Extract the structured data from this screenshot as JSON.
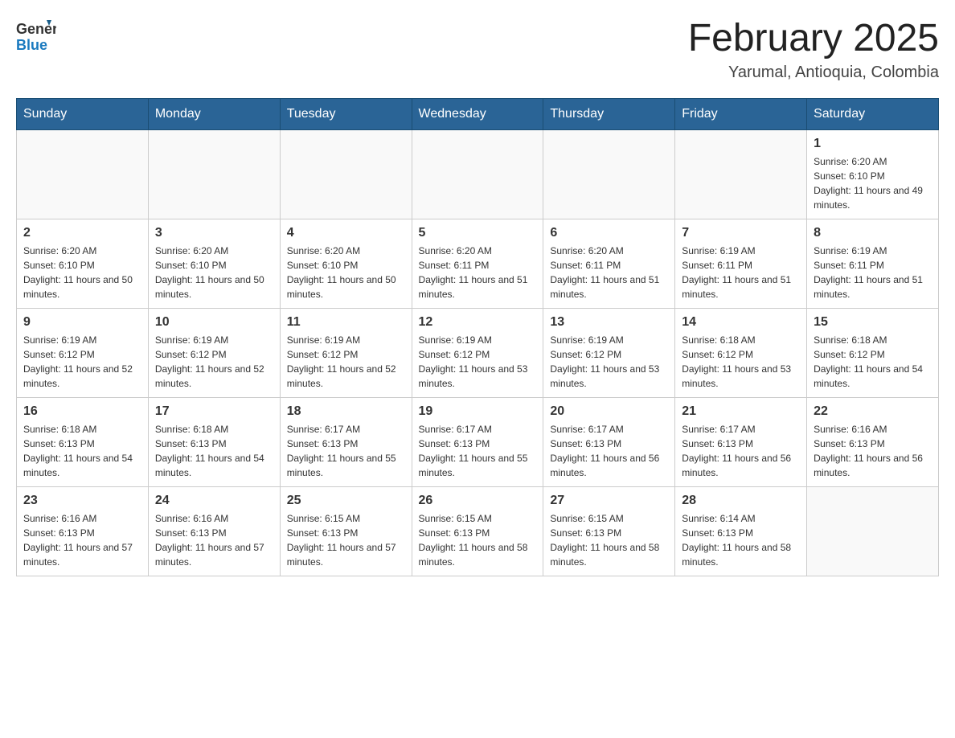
{
  "header": {
    "logo_general": "General",
    "logo_blue": "Blue",
    "month_title": "February 2025",
    "location": "Yarumal, Antioquia, Colombia"
  },
  "days_of_week": [
    "Sunday",
    "Monday",
    "Tuesday",
    "Wednesday",
    "Thursday",
    "Friday",
    "Saturday"
  ],
  "weeks": [
    [
      {
        "day": "",
        "sunrise": "",
        "sunset": "",
        "daylight": ""
      },
      {
        "day": "",
        "sunrise": "",
        "sunset": "",
        "daylight": ""
      },
      {
        "day": "",
        "sunrise": "",
        "sunset": "",
        "daylight": ""
      },
      {
        "day": "",
        "sunrise": "",
        "sunset": "",
        "daylight": ""
      },
      {
        "day": "",
        "sunrise": "",
        "sunset": "",
        "daylight": ""
      },
      {
        "day": "",
        "sunrise": "",
        "sunset": "",
        "daylight": ""
      },
      {
        "day": "1",
        "sunrise": "Sunrise: 6:20 AM",
        "sunset": "Sunset: 6:10 PM",
        "daylight": "Daylight: 11 hours and 49 minutes."
      }
    ],
    [
      {
        "day": "2",
        "sunrise": "Sunrise: 6:20 AM",
        "sunset": "Sunset: 6:10 PM",
        "daylight": "Daylight: 11 hours and 50 minutes."
      },
      {
        "day": "3",
        "sunrise": "Sunrise: 6:20 AM",
        "sunset": "Sunset: 6:10 PM",
        "daylight": "Daylight: 11 hours and 50 minutes."
      },
      {
        "day": "4",
        "sunrise": "Sunrise: 6:20 AM",
        "sunset": "Sunset: 6:10 PM",
        "daylight": "Daylight: 11 hours and 50 minutes."
      },
      {
        "day": "5",
        "sunrise": "Sunrise: 6:20 AM",
        "sunset": "Sunset: 6:11 PM",
        "daylight": "Daylight: 11 hours and 51 minutes."
      },
      {
        "day": "6",
        "sunrise": "Sunrise: 6:20 AM",
        "sunset": "Sunset: 6:11 PM",
        "daylight": "Daylight: 11 hours and 51 minutes."
      },
      {
        "day": "7",
        "sunrise": "Sunrise: 6:19 AM",
        "sunset": "Sunset: 6:11 PM",
        "daylight": "Daylight: 11 hours and 51 minutes."
      },
      {
        "day": "8",
        "sunrise": "Sunrise: 6:19 AM",
        "sunset": "Sunset: 6:11 PM",
        "daylight": "Daylight: 11 hours and 51 minutes."
      }
    ],
    [
      {
        "day": "9",
        "sunrise": "Sunrise: 6:19 AM",
        "sunset": "Sunset: 6:12 PM",
        "daylight": "Daylight: 11 hours and 52 minutes."
      },
      {
        "day": "10",
        "sunrise": "Sunrise: 6:19 AM",
        "sunset": "Sunset: 6:12 PM",
        "daylight": "Daylight: 11 hours and 52 minutes."
      },
      {
        "day": "11",
        "sunrise": "Sunrise: 6:19 AM",
        "sunset": "Sunset: 6:12 PM",
        "daylight": "Daylight: 11 hours and 52 minutes."
      },
      {
        "day": "12",
        "sunrise": "Sunrise: 6:19 AM",
        "sunset": "Sunset: 6:12 PM",
        "daylight": "Daylight: 11 hours and 53 minutes."
      },
      {
        "day": "13",
        "sunrise": "Sunrise: 6:19 AM",
        "sunset": "Sunset: 6:12 PM",
        "daylight": "Daylight: 11 hours and 53 minutes."
      },
      {
        "day": "14",
        "sunrise": "Sunrise: 6:18 AM",
        "sunset": "Sunset: 6:12 PM",
        "daylight": "Daylight: 11 hours and 53 minutes."
      },
      {
        "day": "15",
        "sunrise": "Sunrise: 6:18 AM",
        "sunset": "Sunset: 6:12 PM",
        "daylight": "Daylight: 11 hours and 54 minutes."
      }
    ],
    [
      {
        "day": "16",
        "sunrise": "Sunrise: 6:18 AM",
        "sunset": "Sunset: 6:13 PM",
        "daylight": "Daylight: 11 hours and 54 minutes."
      },
      {
        "day": "17",
        "sunrise": "Sunrise: 6:18 AM",
        "sunset": "Sunset: 6:13 PM",
        "daylight": "Daylight: 11 hours and 54 minutes."
      },
      {
        "day": "18",
        "sunrise": "Sunrise: 6:17 AM",
        "sunset": "Sunset: 6:13 PM",
        "daylight": "Daylight: 11 hours and 55 minutes."
      },
      {
        "day": "19",
        "sunrise": "Sunrise: 6:17 AM",
        "sunset": "Sunset: 6:13 PM",
        "daylight": "Daylight: 11 hours and 55 minutes."
      },
      {
        "day": "20",
        "sunrise": "Sunrise: 6:17 AM",
        "sunset": "Sunset: 6:13 PM",
        "daylight": "Daylight: 11 hours and 56 minutes."
      },
      {
        "day": "21",
        "sunrise": "Sunrise: 6:17 AM",
        "sunset": "Sunset: 6:13 PM",
        "daylight": "Daylight: 11 hours and 56 minutes."
      },
      {
        "day": "22",
        "sunrise": "Sunrise: 6:16 AM",
        "sunset": "Sunset: 6:13 PM",
        "daylight": "Daylight: 11 hours and 56 minutes."
      }
    ],
    [
      {
        "day": "23",
        "sunrise": "Sunrise: 6:16 AM",
        "sunset": "Sunset: 6:13 PM",
        "daylight": "Daylight: 11 hours and 57 minutes."
      },
      {
        "day": "24",
        "sunrise": "Sunrise: 6:16 AM",
        "sunset": "Sunset: 6:13 PM",
        "daylight": "Daylight: 11 hours and 57 minutes."
      },
      {
        "day": "25",
        "sunrise": "Sunrise: 6:15 AM",
        "sunset": "Sunset: 6:13 PM",
        "daylight": "Daylight: 11 hours and 57 minutes."
      },
      {
        "day": "26",
        "sunrise": "Sunrise: 6:15 AM",
        "sunset": "Sunset: 6:13 PM",
        "daylight": "Daylight: 11 hours and 58 minutes."
      },
      {
        "day": "27",
        "sunrise": "Sunrise: 6:15 AM",
        "sunset": "Sunset: 6:13 PM",
        "daylight": "Daylight: 11 hours and 58 minutes."
      },
      {
        "day": "28",
        "sunrise": "Sunrise: 6:14 AM",
        "sunset": "Sunset: 6:13 PM",
        "daylight": "Daylight: 11 hours and 58 minutes."
      },
      {
        "day": "",
        "sunrise": "",
        "sunset": "",
        "daylight": ""
      }
    ]
  ]
}
